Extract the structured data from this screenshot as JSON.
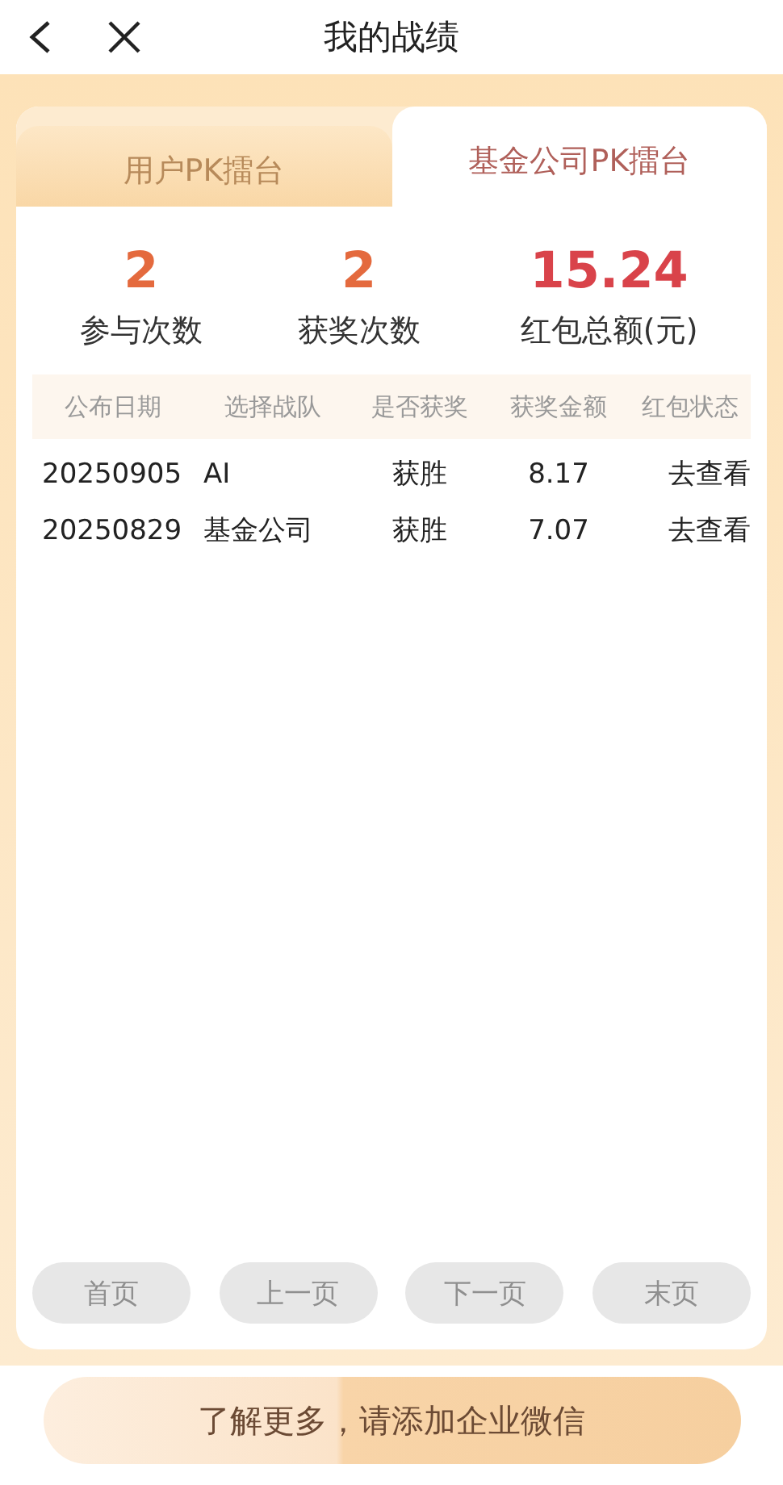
{
  "header": {
    "title": "我的战绩"
  },
  "tabs": [
    {
      "label": "用户PK擂台",
      "selected": false
    },
    {
      "label": "基金公司PK擂台",
      "selected": true
    }
  ],
  "stats": [
    {
      "value": "2",
      "label": "参与次数",
      "kind": "count"
    },
    {
      "value": "2",
      "label": "获奖次数",
      "kind": "count"
    },
    {
      "value": "15.24",
      "label": "红包总额(元)",
      "kind": "money"
    }
  ],
  "table": {
    "columns": [
      "公布日期",
      "选择战队",
      "是否获奖",
      "获奖金额",
      "红包状态"
    ],
    "rows": [
      [
        "20250905",
        "AI",
        "获胜",
        "8.17",
        "去查看"
      ],
      [
        "20250829",
        "基金公司",
        "获胜",
        "7.07",
        "去查看"
      ]
    ]
  },
  "pagination": [
    {
      "label": "首页",
      "disabled": true
    },
    {
      "label": "上一页",
      "disabled": true
    },
    {
      "label": "下一页",
      "disabled": true
    },
    {
      "label": "末页",
      "disabled": true
    }
  ],
  "banner": {
    "text": "了解更多，请添加企业微信"
  }
}
